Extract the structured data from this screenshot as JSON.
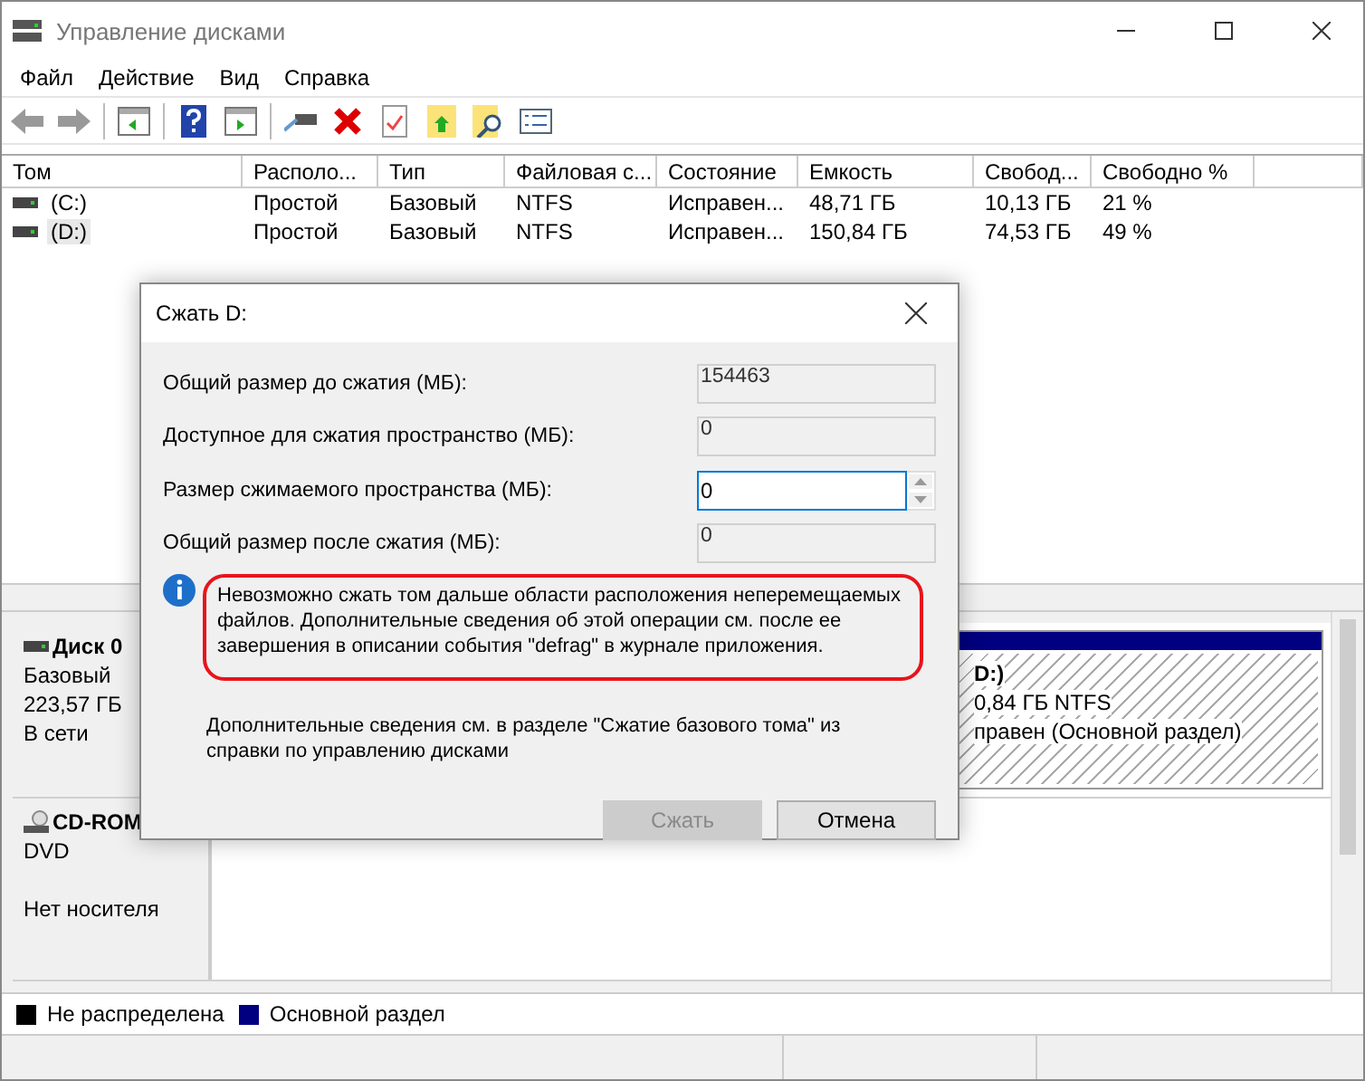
{
  "window": {
    "title": "Управление дисками"
  },
  "menu": [
    "Файл",
    "Действие",
    "Вид",
    "Справка"
  ],
  "volumes": {
    "columns": [
      "Том",
      "Располо...",
      "Тип",
      "Файловая с...",
      "Состояние",
      "Емкость",
      "Свобод...",
      "Свободно %"
    ],
    "rows": [
      {
        "selected": false,
        "cells": [
          "(C:)",
          "Простой",
          "Базовый",
          "NTFS",
          "Исправен...",
          "48,71 ГБ",
          "10,13 ГБ",
          "21 %"
        ]
      },
      {
        "selected": true,
        "cells": [
          "(D:)",
          "Простой",
          "Базовый",
          "NTFS",
          "Исправен...",
          "150,84 ГБ",
          "74,53 ГБ",
          "49 %"
        ]
      }
    ]
  },
  "disks": [
    {
      "kind": "hdd",
      "name": "Диск 0",
      "type": "Базовый",
      "size": "223,57 ГБ",
      "status": "В сети",
      "partitions": [
        {
          "lines": [
            "D:)",
            "0,84 ГБ NTFS",
            "правен (Основной раздел)"
          ],
          "color": "#000080"
        }
      ]
    },
    {
      "kind": "cdrom",
      "name": "CD-ROM",
      "type": "DVD",
      "status": "Нет носителя"
    }
  ],
  "legend": [
    {
      "label": "Не распределена",
      "color": "#000000"
    },
    {
      "label": "Основной раздел",
      "color": "#000080"
    }
  ],
  "dialog": {
    "title": "Сжать D:",
    "fields": [
      {
        "kind": "readonly",
        "label": "Общий размер до сжатия (МБ):",
        "value": "154463"
      },
      {
        "kind": "readonly",
        "label": "Доступное для сжатия пространство (МБ):",
        "value": "0"
      },
      {
        "kind": "spin",
        "label": "Размер сжимаемого пространства (МБ):",
        "value": "0"
      },
      {
        "kind": "readonly",
        "label": "Общий размер после сжатия (МБ):",
        "value": "0"
      }
    ],
    "message": "Невозможно сжать том дальше области расположения неперемещаемых файлов. Дополнительные сведения об этой операции см. после ее завершения в описании события \"defrag\" в журнале приложения.",
    "help": "Дополнительные сведения см. в разделе \"Сжатие базового тома\" из справки по управлению дисками",
    "buttons": [
      {
        "label": "Сжать",
        "disabled": true
      },
      {
        "label": "Отмена",
        "disabled": false
      }
    ]
  }
}
